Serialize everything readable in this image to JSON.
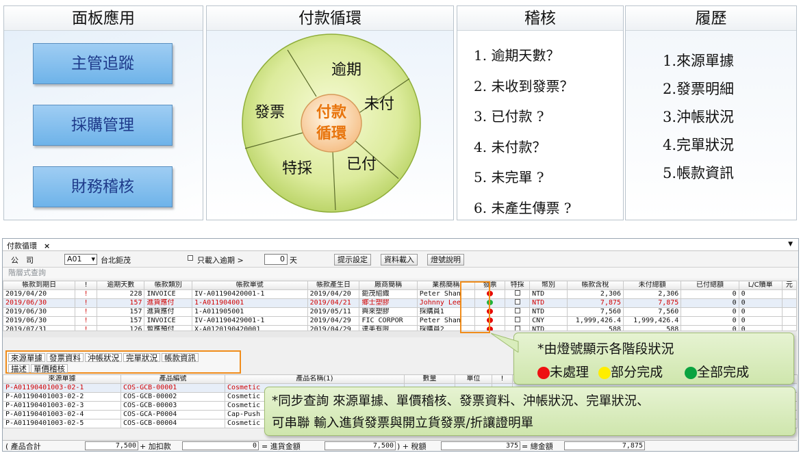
{
  "panels": {
    "app_panel": {
      "title": "面板應用",
      "buttons": [
        "主管追蹤",
        "採購管理",
        "財務稽核"
      ]
    },
    "cycle_panel": {
      "title": "付款循環",
      "center": [
        "付款",
        "循環"
      ],
      "segments": [
        "逾期",
        "未付",
        "已付",
        "特採",
        "發票"
      ]
    },
    "audit_panel": {
      "title": "稽核",
      "items": [
        "1. 逾期天數？",
        "2. 未收到發票？",
        "3. 已付款 ?",
        "4. 未付款？",
        "5. 未完單 ?",
        "6. 未產生傳票 ?"
      ]
    },
    "history_panel": {
      "title": "履歷",
      "items": [
        {
          "num": "1.",
          "text": "來源單據"
        },
        {
          "num": "2.",
          "text": "發票明細"
        },
        {
          "num": "3.",
          "text": "沖帳狀況"
        },
        {
          "num": "4.",
          "text": "完單狀況"
        },
        {
          "num": "5.",
          "text": "帳款資訊"
        }
      ]
    }
  },
  "app": {
    "tab_title": "付款循環",
    "tab_close": "×",
    "filter": {
      "company_label": "公　司",
      "company_code": "A01",
      "company_name": "台北鉅茂",
      "overdue_only_label": "只載入逾期 >",
      "overdue_days": "0",
      "days_unit": "天",
      "btn_settings": "提示設定",
      "btn_load": "資料載入",
      "btn_legend": "燈號說明"
    },
    "section_title": "階層式查詢",
    "main_columns": [
      "帳款到期日",
      "!",
      "逾期天數",
      "帳款類別",
      "帳款單號",
      "帳款產生日",
      "廠商簡稱",
      "業務簡稱",
      "發票",
      "特採",
      "幣別",
      "帳款含稅",
      "未付總額",
      "已付總額",
      "L/C贖單",
      "元"
    ],
    "main_rows": [
      {
        "due": "2019/04/20",
        "flag": "!",
        "days": "228",
        "type": "INVOICE",
        "no": "IV-A01190420001-1",
        "created": "2019/04/20",
        "vendor": "鉅茂組織",
        "sales": "Peter Shan",
        "light": "#e60000",
        "cur": "NTD",
        "amt": "2,306",
        "unpaid": "2,306",
        "paid": "0",
        "lc": "0",
        "red": false,
        "sel": false
      },
      {
        "due": "2019/06/30",
        "flag": "!",
        "days": "157",
        "type": "進貨應付",
        "no": "1-A011904001",
        "created": "2019/04/21",
        "vendor": "鄉士塑膠",
        "sales": "Johnny Lee",
        "light": "#1fb33a",
        "cur": "NTD",
        "amt": "7,875",
        "unpaid": "7,875",
        "paid": "0",
        "lc": "0",
        "red": true,
        "sel": true
      },
      {
        "due": "2019/06/30",
        "flag": "!",
        "days": "157",
        "type": "進貨應付",
        "no": "1-A011905001",
        "created": "2019/05/11",
        "vendor": "興來塑膠",
        "sales": "採購員1",
        "light": "#e60000",
        "cur": "NTD",
        "amt": "7,560",
        "unpaid": "7,560",
        "paid": "0",
        "lc": "0",
        "red": false,
        "sel": false
      },
      {
        "due": "2019/06/30",
        "flag": "!",
        "days": "157",
        "type": "INVOICE",
        "no": "IV-A01190429001-1",
        "created": "2019/04/29",
        "vendor": "FIC CORPOR",
        "sales": "Peter Shan",
        "light": "#e60000",
        "cur": "CNY",
        "amt": "1,999,426.4",
        "unpaid": "1,999,426.4",
        "paid": "0",
        "lc": "0",
        "red": false,
        "sel": false
      },
      {
        "due": "2019/07/31",
        "flag": "!",
        "days": "126",
        "type": "暫應預付",
        "no": "X-A0120190420001",
        "created": "2019/04/29",
        "vendor": "達美有限",
        "sales": "採購員2",
        "light": "#e60000",
        "cur": "NTD",
        "amt": "588",
        "unpaid": "588",
        "paid": "0",
        "lc": "0",
        "red": false,
        "sel": false
      }
    ],
    "subtabs_row1": [
      "來源單據",
      "發票資料",
      "沖帳狀況",
      "完單狀況",
      "帳款資訊"
    ],
    "subtabs_row2": [
      "描述",
      "單價稽核"
    ],
    "detail_columns": [
      "來源單據",
      "產品編號",
      "產品名稱(1)",
      "數量",
      "單位",
      "!",
      "未稅"
    ],
    "detail_rows": [
      {
        "src": "P-A01190401003-02-1",
        "code": "COS-GCB-00001",
        "name": "Cosmetic",
        "red": true
      },
      {
        "src": "P-A01190401003-02-2",
        "code": "COS-GCB-00002",
        "name": "Cosmetic",
        "red": false
      },
      {
        "src": "P-A01190401003-02-3",
        "code": "COS-GCB-00003",
        "name": "Cosmetic",
        "red": false
      },
      {
        "src": "P-A01190401003-02-4",
        "code": "COS-GCA-P0004",
        "name": "Cap-Push",
        "red": false
      },
      {
        "src": "P-A01190401003-02-5",
        "code": "COS-GCB-00004",
        "name": "Cosmetic",
        "red": false
      }
    ],
    "totals": {
      "product_label": "( 產品合計",
      "product_total": "7,500",
      "plus_label": "+ 加扣款",
      "plus_value": "0",
      "goods_label": "= 進貨金額",
      "goods_value": "7,500",
      "tax_label": ") + 稅額",
      "tax_value": "375",
      "sum_label": "= 總金額",
      "sum_value": "7,875"
    }
  },
  "callouts": {
    "light_title": "*由燈號顯示各階段狀況",
    "legend": [
      {
        "label": "未處理",
        "color": "#ee1111"
      },
      {
        "label": "部分完成",
        "color": "#ffee00"
      },
      {
        "label": "全部完成",
        "color": "#0aa340"
      }
    ],
    "sync_line1": "*同步查詢 來源單據、單價稽核、發票資料、沖帳狀況、完單狀況、",
    "sync_line2": "可串聯 輸入進貨發票與開立貨發票/折讓證明單"
  }
}
